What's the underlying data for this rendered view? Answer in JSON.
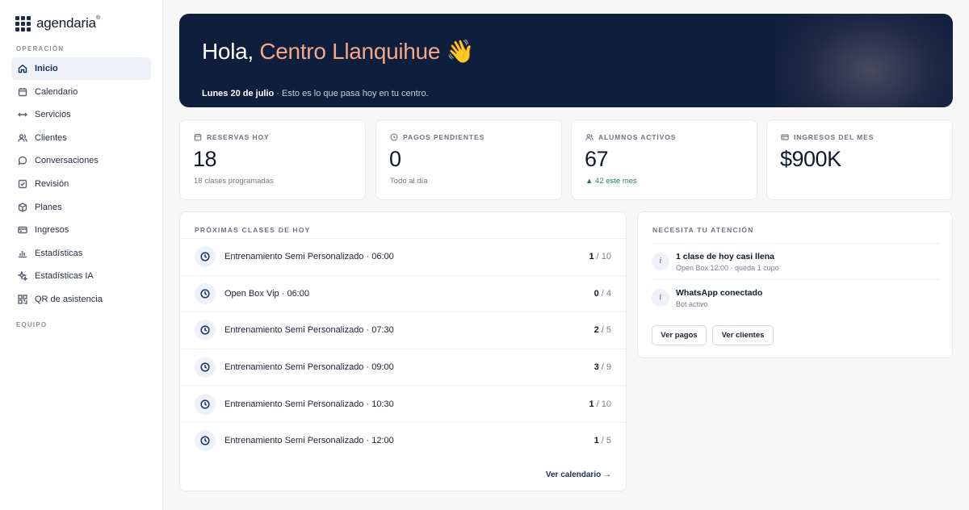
{
  "brand": {
    "name": "agendaria",
    "mark": "®"
  },
  "sidebar": {
    "section_operacion": "OPERACIÓN",
    "section_equipo": "EQUIPO",
    "items": [
      {
        "label": "Inicio",
        "icon": "home-icon",
        "active": true
      },
      {
        "label": "Calendario",
        "icon": "calendar-icon"
      },
      {
        "label": "Servicios",
        "icon": "arrows-icon"
      },
      {
        "label": "Clientes",
        "icon": "users-icon"
      },
      {
        "label": "Conversaciones",
        "icon": "chat-icon"
      },
      {
        "label": "Revisión",
        "icon": "checkbox-icon"
      },
      {
        "label": "Planes",
        "icon": "box-icon"
      },
      {
        "label": "Ingresos",
        "icon": "card-icon"
      },
      {
        "label": "Estadísticas",
        "icon": "bars-icon"
      },
      {
        "label": "Estadísticas IA",
        "icon": "sparkle-icon"
      },
      {
        "label": "QR de asistencia",
        "icon": "qr-icon"
      }
    ]
  },
  "hero": {
    "greeting": "Hola, ",
    "center_name": "Centro Llanquihue",
    "emoji": "👋",
    "date": "Lunes 20 de julio",
    "subtitle": " · Esto es lo que pasa hoy en tu centro."
  },
  "stats": [
    {
      "label": "RESERVAS HOY",
      "icon": "calendar-icon",
      "value": "18",
      "note": "18 clases programadas",
      "trend": ""
    },
    {
      "label": "PAGOS PENDIENTES",
      "icon": "clock-icon",
      "value": "0",
      "note": "Todo al día",
      "trend": ""
    },
    {
      "label": "ALUMNOS ACTIVOS",
      "icon": "users-icon",
      "value": "67",
      "note": "▲ 42 este mes",
      "trend": "up"
    },
    {
      "label": "INGRESOS DEL MES",
      "icon": "card-icon",
      "value": "$900K",
      "note": "",
      "trend": ""
    }
  ],
  "classes": {
    "title": "PRÓXIMAS CLASES DE HOY",
    "rows": [
      {
        "name": "Entrenamiento Semi Personalizado · 06:00",
        "booked": "1",
        "capacity": " / 10"
      },
      {
        "name": "Open Box Vip · 06:00",
        "booked": "0",
        "capacity": " / 4"
      },
      {
        "name": "Entrenamiento Semi Personalizado · 07:30",
        "booked": "2",
        "capacity": " / 5"
      },
      {
        "name": "Entrenamiento Semi Personalizado · 09:00",
        "booked": "3",
        "capacity": " / 9"
      },
      {
        "name": "Entrenamiento Semi Personalizado · 10:30",
        "booked": "1",
        "capacity": " / 10"
      },
      {
        "name": "Entrenamiento Semi Personalizado · 12:00",
        "booked": "1",
        "capacity": " / 5"
      }
    ],
    "link": "Ver calendario →"
  },
  "attention": {
    "title": "NECESITA TU ATENCIÓN",
    "items": [
      {
        "icon_glyph": "i",
        "title": "1 clase de hoy casi llena",
        "sub": "Open Box 12:00 · queda 1 cupo"
      },
      {
        "icon_glyph": "i",
        "title": "WhatsApp conectado",
        "sub": "Bot activo"
      }
    ],
    "btn_pagos": "Ver pagos",
    "btn_clientes": "Ver clientes"
  }
}
